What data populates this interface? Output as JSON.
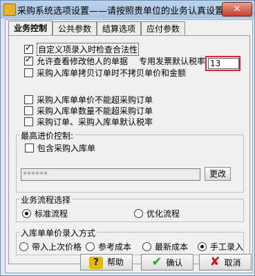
{
  "window": {
    "title": "采购系统选项设置——请按照贵单位的业务认真设置",
    "close_glyph": "✕"
  },
  "tabs": [
    {
      "label": "业务控制"
    },
    {
      "label": "公共参数"
    },
    {
      "label": "结算选项"
    },
    {
      "label": "应付参数"
    }
  ],
  "options": {
    "custom_item_check": {
      "label": "自定义项录入时检查合法性",
      "checked": true
    },
    "allow_modify_others": {
      "label": "允许查看修改他人的单据",
      "checked": true
    },
    "tax_rate_label": "专用发票默认税率:",
    "tax_rate_value": "13",
    "inbound_copy_no_price": {
      "label": "采购入库单拷贝订单时不拷贝单价和金额",
      "checked": false
    },
    "price_not_exceed_order": {
      "label": "采购入库单单价不能超采购订单",
      "checked": false
    },
    "qty_not_exceed_order": {
      "label": "采购入库单数量不能超采购订单",
      "checked": false
    },
    "default_tax_rate": {
      "label": "采购订单、采购入库单默认税率",
      "checked": false
    }
  },
  "max_price_control": {
    "legend": "最高进价控制:",
    "include_inbound": {
      "label": "包含采购入库单",
      "checked": false
    },
    "password_value": "******",
    "change_button": "更改"
  },
  "business_flow": {
    "legend": "业务流程选择",
    "options": [
      {
        "label": "标准流程",
        "selected": true
      },
      {
        "label": "优化流程",
        "selected": false
      }
    ]
  },
  "inbound_price_mode": {
    "legend": "入库单单价录入方式",
    "options": [
      {
        "label": "带入上次价格",
        "selected": false
      },
      {
        "label": "参考成本",
        "selected": false
      },
      {
        "label": "最新成本",
        "selected": false
      },
      {
        "label": "手工录入",
        "selected": true
      }
    ]
  },
  "footer": {
    "help_label": "帮助",
    "help_icon_text": "?",
    "ok_label": "确认",
    "ok_icon_text": "✔",
    "cancel_label": "取消",
    "cancel_icon_text": "✘"
  },
  "colors": {
    "highlight": "#d9262b",
    "link_tab_text": "#1a3d9e"
  }
}
